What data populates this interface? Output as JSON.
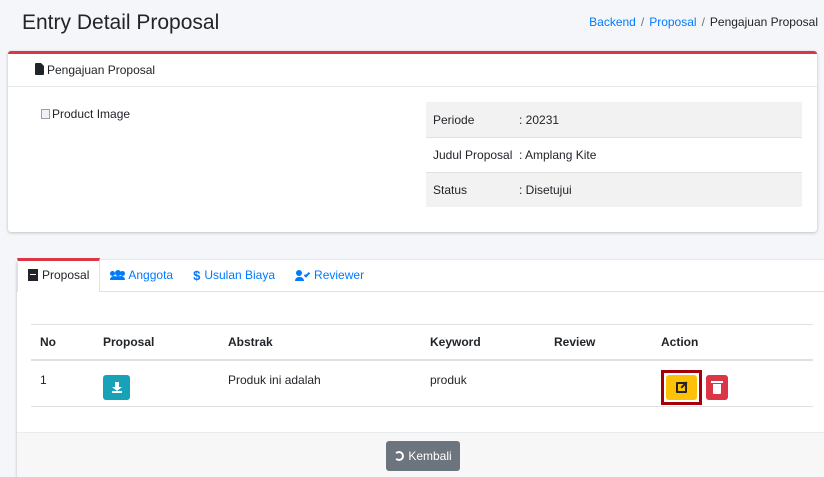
{
  "page": {
    "title": "Entry Detail Proposal"
  },
  "breadcrumb": {
    "items": [
      "Backend",
      "Proposal"
    ],
    "separator": "/",
    "active": "Pengajuan Proposal"
  },
  "detail_card": {
    "header": "Pengajuan Proposal",
    "image_alt": "Product Image",
    "rows": [
      {
        "key": "Periode",
        "value": ": 20231"
      },
      {
        "key": "Judul Proposal",
        "value": ": Amplang Kite"
      },
      {
        "key": "Status",
        "value": ": Disetujui"
      }
    ]
  },
  "tabs": [
    {
      "label": "Proposal",
      "icon": "file-pdf-icon",
      "active": true
    },
    {
      "label": "Anggota",
      "icon": "users-icon",
      "active": false
    },
    {
      "label": "Usulan Biaya",
      "icon": "dollar-icon",
      "active": false
    },
    {
      "label": "Reviewer",
      "icon": "user-check-icon",
      "active": false
    }
  ],
  "table": {
    "headers": [
      "No",
      "Proposal",
      "Abstrak",
      "Keyword",
      "Review",
      "Action"
    ],
    "rows": [
      {
        "no": "1",
        "abstrak": "Produk ini adalah",
        "keyword": "produk",
        "review": ""
      }
    ]
  },
  "footer": {
    "back_label": "Kembali"
  },
  "colors": {
    "accent_red": "#dc3545",
    "link_blue": "#007bff",
    "info": "#17a2b8",
    "warning": "#ffc107",
    "secondary": "#6c757d",
    "highlight": "#a3000a"
  }
}
